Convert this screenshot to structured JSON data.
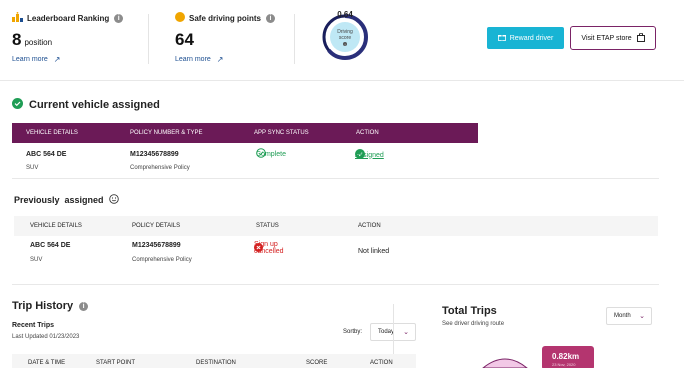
{
  "header": {
    "leaderboard": {
      "label": "Leaderboard Ranking",
      "value": "8",
      "unit": "position",
      "link": "Learn more"
    },
    "safe_points": {
      "label": "Safe driving points",
      "value": "64",
      "link": "Learn more"
    },
    "gauge": {
      "value": "0.64",
      "label_line1": "Driving",
      "label_line2": "score",
      "fill_fraction": 0.64
    },
    "reward_button": "Reward driver",
    "store_button": "Visit ETAP store"
  },
  "current_vehicle": {
    "title": "Current vehicle assigned",
    "columns": [
      "VEHICLE DETAILS",
      "POLICY NUMBER & TYPE",
      "APP SYNC STATUS",
      "ACTION"
    ],
    "row": {
      "vehicle": "ABC 564 DE",
      "vehicle_type": "SUV",
      "policy": "M12345678899",
      "policy_type": "Comprehensive Policy",
      "sync": "Complete",
      "action": "Assigned"
    }
  },
  "previous": {
    "title": "Previously  assigned",
    "columns": [
      "VEHICLE DETAILS",
      "POLICY DETAILS",
      "STATUS",
      "ACTION"
    ],
    "row": {
      "vehicle": "ABC 564 DE",
      "vehicle_type": "SUV",
      "policy": "M12345678899",
      "policy_type": "Comprehensive Policy",
      "status": "Sign up cancelled",
      "action": "Not linked"
    }
  },
  "trip_history": {
    "title": "Trip History",
    "recent": "Recent Trips",
    "updated": "Last Updated 01/23/2023",
    "sortby_label": "Sortby:",
    "sort_value": "Today",
    "columns": [
      "DATE & TIME",
      "START POINT",
      "DESTINATION",
      "SCORE",
      "ACTION"
    ]
  },
  "total_trips": {
    "title": "Total Trips",
    "subtitle": "See driver driving route",
    "period": "Month",
    "tooltip_value": "0.82km",
    "tooltip_date": "23 Nov, 2020"
  },
  "colors": {
    "brand_purple": "#6b1a57",
    "accent_cyan": "#18b4d4",
    "success": "#1f9d55",
    "danger": "#d42020",
    "tooltip": "#b4356f"
  }
}
